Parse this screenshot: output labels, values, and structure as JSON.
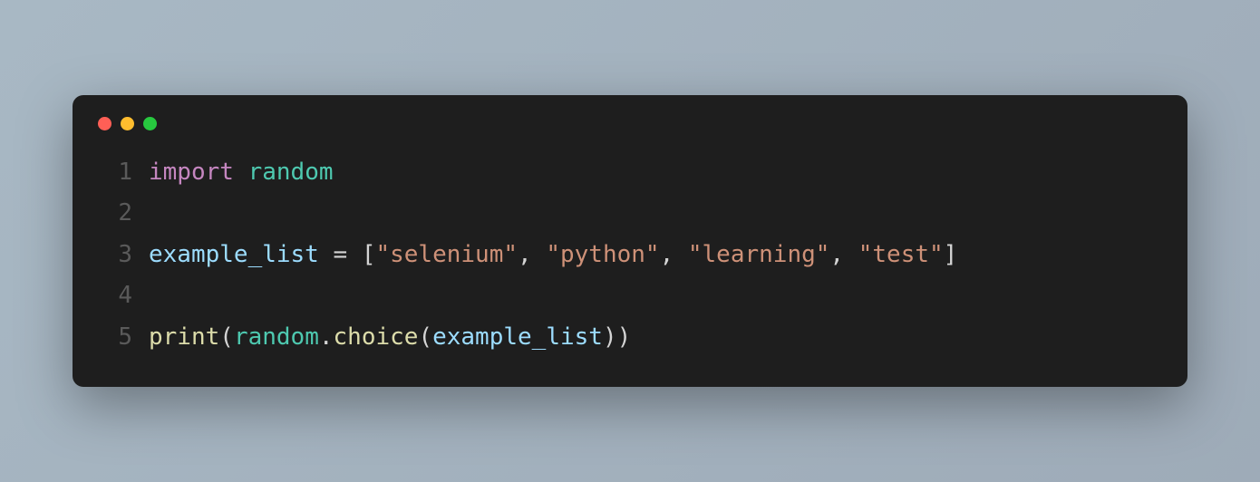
{
  "window": {
    "dots": [
      "red",
      "yellow",
      "green"
    ]
  },
  "code": {
    "line_numbers": [
      "1",
      "2",
      "3",
      "4",
      "5"
    ],
    "line1": {
      "import_kw": "import",
      "sp1": " ",
      "module": "random"
    },
    "line3": {
      "var": "example_list",
      "sp1": " ",
      "eq": "=",
      "sp2": " ",
      "lbracket": "[",
      "s1": "\"selenium\"",
      "c1": ",",
      "sp3": " ",
      "s2": "\"python\"",
      "c2": ",",
      "sp4": " ",
      "s3": "\"learning\"",
      "c3": ",",
      "sp5": " ",
      "s4": "\"test\"",
      "rbracket": "]"
    },
    "line5": {
      "print": "print",
      "lparen1": "(",
      "random": "random",
      "dot": ".",
      "choice": "choice",
      "lparen2": "(",
      "arg": "example_list",
      "rparen2": ")",
      "rparen1": ")"
    }
  }
}
